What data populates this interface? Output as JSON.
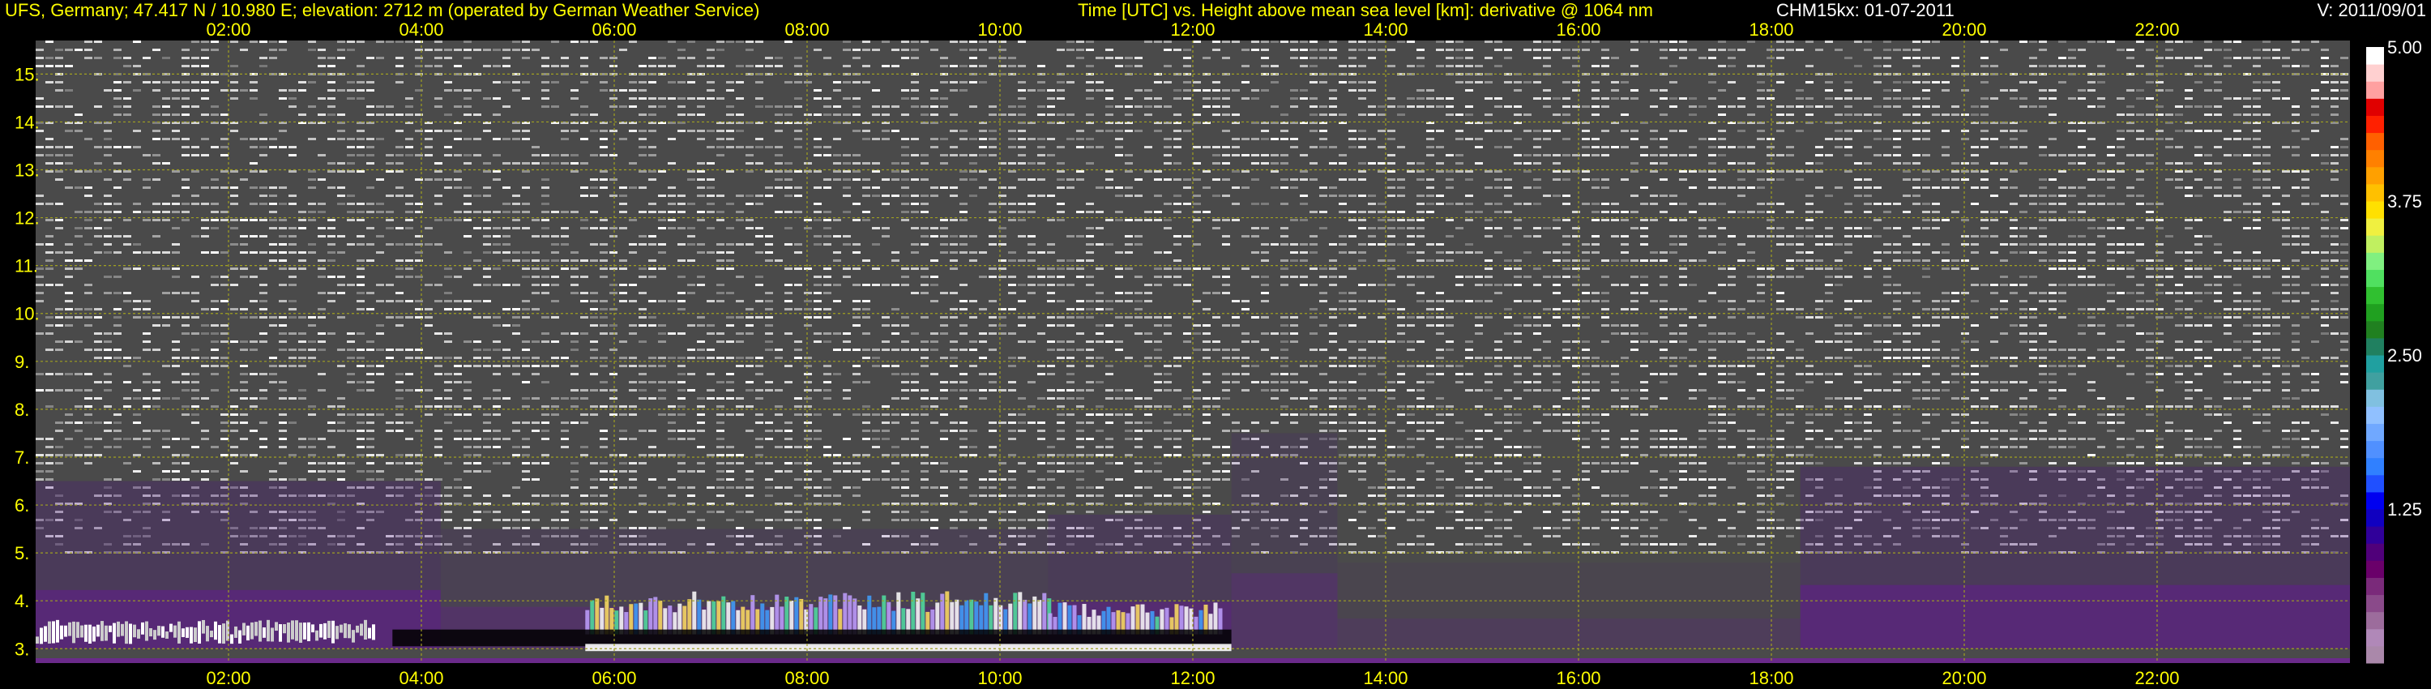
{
  "header": {
    "station": "UFS, Germany; 47.417 N / 10.980 E; elevation: 2712 m  (operated by German Weather Service)",
    "axes": "Time [UTC] vs. Height above mean sea level [km]: derivative @ 1064 nm",
    "instrument": "CHM15kx: 01-07-2011",
    "version": "V: 2011/09/01"
  },
  "colors": {
    "background": "#000000",
    "header_text": "#ffff00",
    "grid": "#a0a020",
    "label_text": "#ffffff"
  },
  "chart_data": {
    "type": "heatmap",
    "title": "Time [UTC] vs. Height above mean sea level [km]: derivative @ 1064 nm",
    "x": {
      "unit": "hours UTC",
      "range": [
        0,
        24
      ],
      "ticks": [
        2,
        4,
        6,
        8,
        10,
        12,
        14,
        16,
        18,
        20,
        22
      ],
      "tick_labels": [
        "02:00",
        "04:00",
        "06:00",
        "08:00",
        "10:00",
        "12:00",
        "14:00",
        "16:00",
        "18:00",
        "20:00",
        "22:00"
      ]
    },
    "y": {
      "unit": "km",
      "range": [
        2.7,
        15.7
      ],
      "ticks": [
        3,
        4,
        5,
        6,
        7,
        8,
        9,
        10,
        11,
        12,
        13,
        14,
        15
      ],
      "tick_labels": [
        "3.",
        "4.",
        "5.",
        "6.",
        "7.",
        "8.",
        "9.",
        "10.",
        "11.",
        "12.",
        "13.",
        "14.",
        "15."
      ]
    },
    "grid": true,
    "colorbar": {
      "range": [
        0,
        5
      ],
      "tick_values": [
        1.25,
        2.5,
        3.75,
        5.0
      ],
      "tick_labels": [
        "1.25",
        "2.50",
        "3.75",
        "5.00"
      ],
      "colors": [
        "#aa88aa",
        "#b088b8",
        "#9c6c9c",
        "#8a4a8a",
        "#7a2a7a",
        "#6a006a",
        "#50007a",
        "#30009a",
        "#1000c0",
        "#0000f0",
        "#2050ff",
        "#3080ff",
        "#5090ff",
        "#70a8ff",
        "#90c0ff",
        "#80c0e0",
        "#40a0a0",
        "#20a0a0",
        "#208060",
        "#208020",
        "#20a020",
        "#30c030",
        "#50e060",
        "#80f080",
        "#c0f060",
        "#f0f040",
        "#ffe000",
        "#ffc000",
        "#ffa000",
        "#ff8000",
        "#ff6000",
        "#ff2000",
        "#e00000",
        "#ffa0a0",
        "#ffd0d0",
        "#ffffff"
      ]
    },
    "features": [
      {
        "name": "noise",
        "x": [
          0,
          24
        ],
        "y": [
          3.3,
          15.7
        ]
      },
      {
        "name": "aerosol_layer",
        "x": [
          0,
          4.2
        ],
        "y": [
          3.0,
          6.5
        ],
        "intensity": 0.9
      },
      {
        "name": "aerosol_layer",
        "x": [
          4.2,
          10.5
        ],
        "y": [
          3.0,
          5.5
        ],
        "intensity": 0.55
      },
      {
        "name": "aerosol_layer",
        "x": [
          10.5,
          12.4
        ],
        "y": [
          3.0,
          5.8
        ],
        "intensity": 0.8
      },
      {
        "name": "aerosol_layer",
        "x": [
          12.4,
          13.5
        ],
        "y": [
          3.0,
          7.5
        ],
        "intensity": 0.5
      },
      {
        "name": "aerosol_layer",
        "x": [
          13.5,
          18.3
        ],
        "y": [
          3.0,
          4.8
        ],
        "intensity": 0.3
      },
      {
        "name": "aerosol_layer",
        "x": [
          18.3,
          24
        ],
        "y": [
          3.0,
          6.8
        ],
        "intensity": 0.9
      },
      {
        "name": "bright_layer",
        "x": [
          5.7,
          10.5
        ],
        "y": [
          3.3,
          4.2
        ]
      },
      {
        "name": "bright_layer",
        "x": [
          10.5,
          12.3
        ],
        "y": [
          3.3,
          4.0
        ]
      },
      {
        "name": "low_cloud",
        "x": [
          0,
          3.5
        ],
        "y": [
          3.1,
          3.6
        ]
      },
      {
        "name": "dark_band",
        "x": [
          3.7,
          12.4
        ],
        "y": [
          3.05,
          3.4
        ]
      },
      {
        "name": "surface_band",
        "x": [
          5.7,
          12.4
        ],
        "y": [
          2.95,
          3.1
        ]
      }
    ]
  }
}
